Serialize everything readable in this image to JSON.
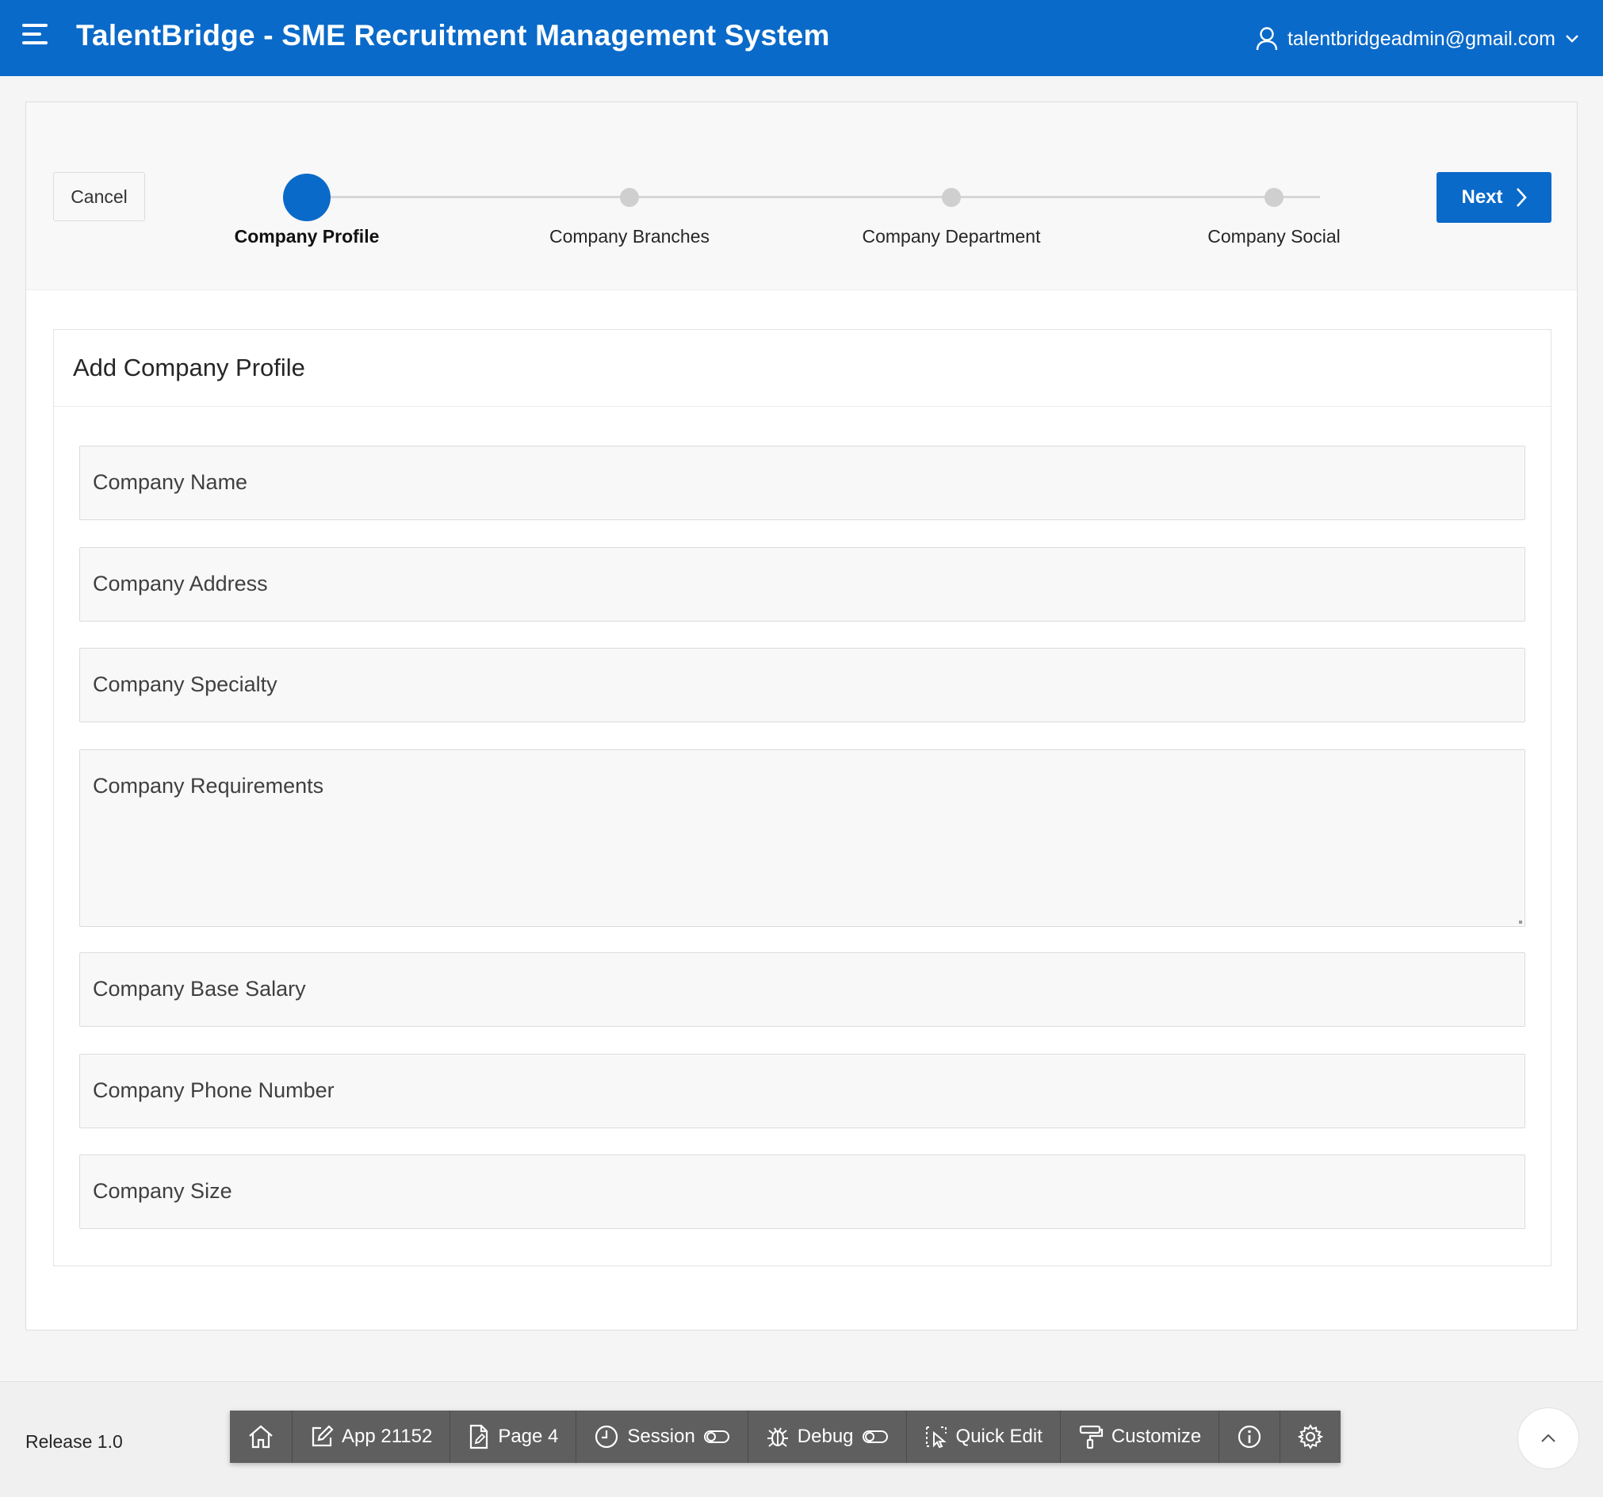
{
  "header": {
    "app_title": "TalentBridge - SME Recruitment Management System",
    "user_email": "talentbridgeadmin@gmail.com",
    "brand_color": "#0a6ac9"
  },
  "wizard": {
    "cancel_label": "Cancel",
    "next_label": "Next",
    "steps": [
      {
        "label": "Company Profile",
        "active": true
      },
      {
        "label": "Company Branches",
        "active": false
      },
      {
        "label": "Company Department",
        "active": false
      },
      {
        "label": "Company Social",
        "active": false
      }
    ]
  },
  "form": {
    "title": "Add Company Profile",
    "fields": [
      {
        "label": "Company Name",
        "type": "text",
        "value": ""
      },
      {
        "label": "Company Address",
        "type": "text",
        "value": ""
      },
      {
        "label": "Company Specialty",
        "type": "text",
        "value": ""
      },
      {
        "label": "Company Requirements",
        "type": "textarea",
        "value": ""
      },
      {
        "label": "Company Base Salary",
        "type": "text",
        "value": ""
      },
      {
        "label": "Company Phone Number",
        "type": "text",
        "value": ""
      },
      {
        "label": "Company Size",
        "type": "text",
        "value": ""
      }
    ]
  },
  "footer": {
    "release": "Release 1.0",
    "devbar": {
      "home_icon": "home-icon",
      "app": "App 21152",
      "page": "Page 4",
      "session": "Session",
      "debug": "Debug",
      "quick_edit": "Quick Edit",
      "customize": "Customize",
      "info_icon": "info-icon",
      "settings_icon": "gear-icon"
    }
  }
}
